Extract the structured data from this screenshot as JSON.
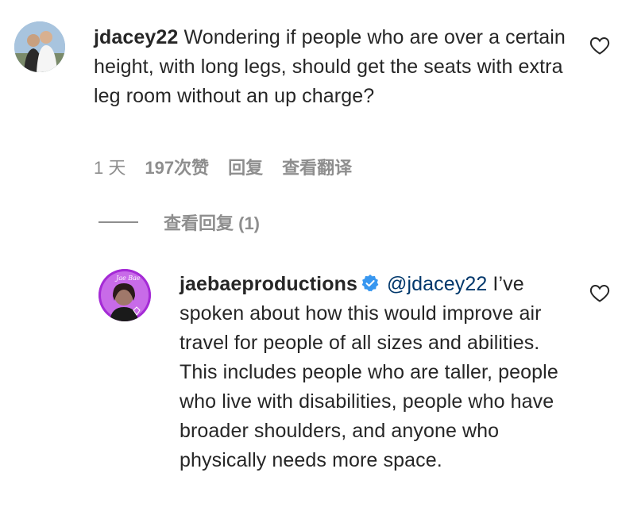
{
  "comment": {
    "username": "jdacey22",
    "text": " Wondering if people who are over a certain height, with long legs, should get the seats with extra leg room without an up charge?",
    "time": "1 天",
    "likes": "197次赞",
    "reply_label": "回复",
    "translate_label": "查看翻译",
    "avatar_icon": "avatar-photo",
    "like_icon": "heart-outline-icon"
  },
  "view_replies": {
    "label": "查看回复 (1)"
  },
  "reply": {
    "username": "jaebaeproductions",
    "verified_icon": "verified-badge-icon",
    "mention": "@jdacey22",
    "text": " I’ve spoken about how this would improve air travel for people of all sizes and abilities. This includes people who are taller, people who live with disabilities, people who have broader shoulders, and anyone who physically needs more space.",
    "avatar_icon": "avatar-photo",
    "like_icon": "heart-outline-icon"
  },
  "colors": {
    "text": "#262626",
    "secondary": "#8e8e8e",
    "mention": "#00376b",
    "verified": "#3897f0",
    "avatar_ring": "#a52bd6"
  }
}
